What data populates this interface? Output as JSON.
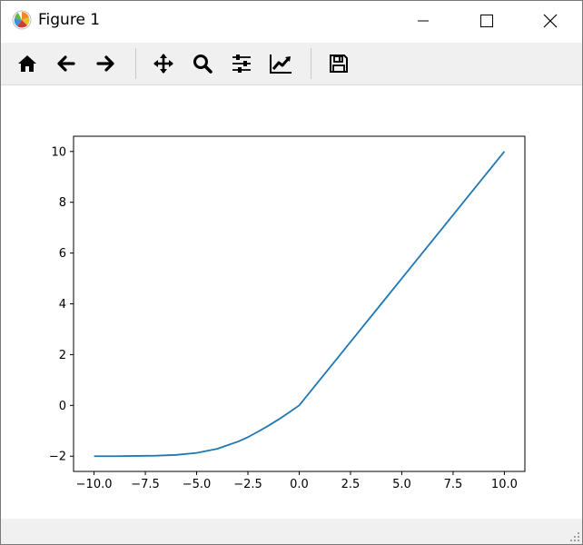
{
  "window": {
    "title": "Figure 1",
    "icons": {
      "app": "matplotlib-icon",
      "minimize": "minimize-icon",
      "maximize": "maximize-icon",
      "close": "close-icon"
    }
  },
  "toolbar": {
    "buttons": [
      {
        "name": "home-icon"
      },
      {
        "name": "back-arrow-icon"
      },
      {
        "name": "forward-arrow-icon"
      },
      {
        "name": "pan-icon"
      },
      {
        "name": "zoom-icon"
      },
      {
        "name": "subplots-icon"
      },
      {
        "name": "edit-axis-icon"
      },
      {
        "name": "save-icon"
      }
    ]
  },
  "colors": {
    "line": "#1f77b4",
    "toolbar_bg": "#f0f0f0"
  },
  "chart_data": {
    "type": "line",
    "title": "",
    "xlabel": "",
    "ylabel": "",
    "xlim": [
      -11.0,
      11.0
    ],
    "ylim": [
      -2.6,
      10.6
    ],
    "xticks": [
      -10.0,
      -7.5,
      -5.0,
      -2.5,
      0.0,
      2.5,
      5.0,
      7.5,
      10.0
    ],
    "xtick_labels": [
      "−10.0",
      "−7.5",
      "−5.0",
      "−2.5",
      "0.0",
      "2.5",
      "5.0",
      "7.5",
      "10.0"
    ],
    "yticks": [
      -2,
      0,
      2,
      4,
      6,
      8,
      10
    ],
    "ytick_labels": [
      "−2",
      "0",
      "2",
      "4",
      "6",
      "8",
      "10"
    ],
    "grid": false,
    "series": [
      {
        "x": [
          -10,
          -9,
          -8,
          -7,
          -6,
          -5,
          -4,
          -3,
          -2.5,
          -2,
          -1.5,
          -1,
          -0.5,
          0,
          0.5,
          1,
          2,
          3,
          4,
          5,
          6,
          7,
          8,
          9,
          10
        ],
        "y": [
          -2.0,
          -2.0,
          -1.99,
          -1.98,
          -1.95,
          -1.87,
          -1.71,
          -1.43,
          -1.25,
          -1.03,
          -0.8,
          -0.55,
          -0.28,
          0.0,
          0.5,
          1.0,
          2.0,
          3.0,
          4.0,
          5.0,
          6.0,
          7.0,
          8.0,
          9.0,
          10.0
        ]
      }
    ]
  }
}
